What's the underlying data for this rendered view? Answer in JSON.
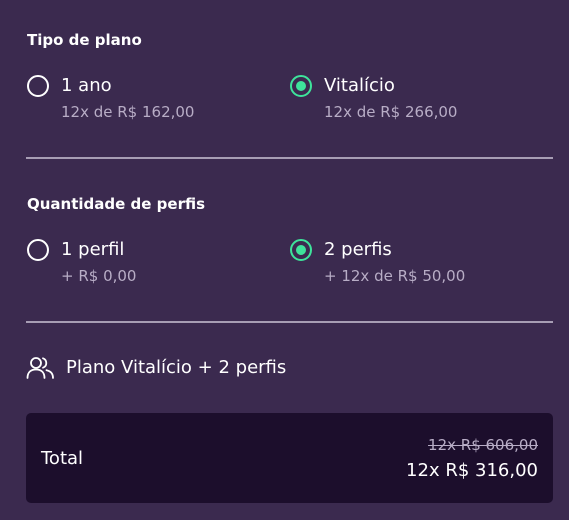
{
  "plan_type": {
    "title": "Tipo de plano",
    "options": [
      {
        "label": "1 ano",
        "price": "12x de R$ 162,00",
        "selected": false
      },
      {
        "label": "Vitalício",
        "price": "12x de R$ 266,00",
        "selected": true
      }
    ]
  },
  "profiles": {
    "title": "Quantidade de perfis",
    "options": [
      {
        "label": "1 perfil",
        "price": "+ R$ 0,00",
        "selected": false
      },
      {
        "label": "2 perfis",
        "price": "+ 12x de R$ 50,00",
        "selected": true
      }
    ]
  },
  "summary": {
    "icon": "users-icon",
    "text": "Plano Vitalício + 2 perfis"
  },
  "total": {
    "label": "Total",
    "old_price": "12x R$ 606,00",
    "new_price": "12x R$ 316,00"
  },
  "colors": {
    "background": "#3b2a4f",
    "accent": "#3ee39b",
    "total_box": "#1c0e2c",
    "muted_text": "#b8adc6",
    "divider": "#a79db4"
  }
}
